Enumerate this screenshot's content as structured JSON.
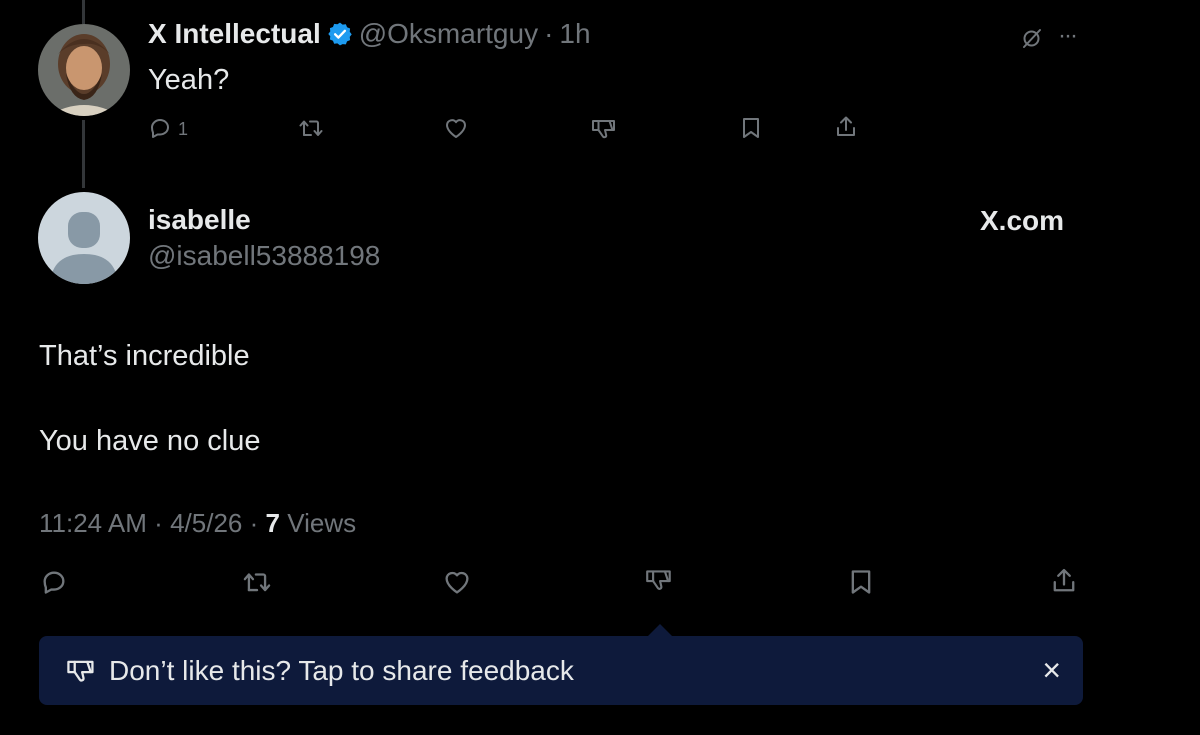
{
  "parent_tweet": {
    "display_name": "X Intellectual",
    "handle": "@Oksmartguy",
    "separator": "·",
    "time": "1h",
    "text": "Yeah?",
    "reply_count": "1",
    "more_label": "···"
  },
  "main_tweet": {
    "display_name": "isabelle",
    "handle": "@isabell53888198",
    "source_badge": "X.com",
    "line1": "That’s incredible",
    "line2": "You have no clue",
    "time": "11:24 AM",
    "date": "4/5/26",
    "views_count": "7",
    "views_label": "Views",
    "sep1": "·",
    "sep2": "·"
  },
  "feedback_banner": {
    "text": "Don’t like this? Tap to share feedback",
    "close_label": "×"
  },
  "colors": {
    "background": "#000000",
    "text_primary": "#e7e9ea",
    "text_secondary": "#71767b",
    "verified_blue": "#1d9bf0",
    "banner_bg": "#0e1a3b"
  },
  "icons": [
    "verified-badge-icon",
    "grok-icon",
    "more-icon",
    "reply-icon",
    "retweet-icon",
    "like-icon",
    "dislike-icon",
    "bookmark-icon",
    "share-icon",
    "close-icon"
  ]
}
